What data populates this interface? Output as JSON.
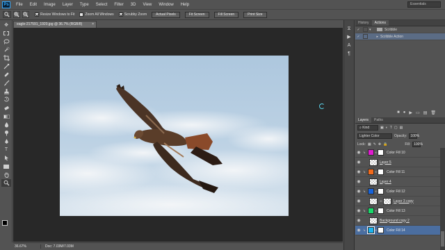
{
  "app": {
    "logo": "Ps",
    "menu": [
      "File",
      "Edit",
      "Image",
      "Layer",
      "Type",
      "Select",
      "Filter",
      "3D",
      "View",
      "Window",
      "Help"
    ],
    "workspace": "Essentials"
  },
  "options": {
    "resize_windows": "Resize Windows to Fit",
    "zoom_all": "Zoom All Windows",
    "scrubby_zoom": "Scrubby Zoom",
    "actual_pixels": "Actual Pixels",
    "fit_screen": "Fit Screen",
    "fill_screen": "Fill Screen",
    "print_size": "Print Size"
  },
  "document": {
    "tab_title": "eagle-217591_1920.jpg @ 36.7% (RGB/8)",
    "close": "×",
    "zoom": "36.67%",
    "doc_info": "Doc: 7.03M/7.03M"
  },
  "actions_panel": {
    "tabs": [
      "History",
      "Actions"
    ],
    "active_tab": "Actions",
    "rows": [
      {
        "label": "Scribble",
        "type": "set"
      },
      {
        "label": "Scribble Action",
        "type": "action"
      }
    ]
  },
  "layers_panel": {
    "tabs": [
      "Layers",
      "Paths"
    ],
    "kind_filter": "Kind",
    "blend_mode": "Lighter Color",
    "opacity_label": "Opacity:",
    "opacity": "100%",
    "lock_label": "Lock:",
    "fill_label": "Fill:",
    "fill": "100%",
    "layers": [
      {
        "name": "Color Fill 10",
        "kind": "fill",
        "color": "#e01ad0",
        "clipped": true
      },
      {
        "name": "Layer 5",
        "kind": "pixel",
        "underline": true
      },
      {
        "name": "Color Fill 11",
        "kind": "fill",
        "color": "#f26a1b",
        "clipped": true
      },
      {
        "name": "Layer 4",
        "kind": "pixel",
        "underline": true
      },
      {
        "name": "Color Fill 12",
        "kind": "fill",
        "color": "#1763d9",
        "clipped": true
      },
      {
        "name": "Layer 3 copy",
        "kind": "pixel-mask",
        "underline": true
      },
      {
        "name": "Color Fill 13",
        "kind": "fill",
        "color": "#19d86a",
        "clipped": true
      },
      {
        "name": "Background copy 2",
        "kind": "pixel",
        "underline": true
      },
      {
        "name": "Color Fill 14",
        "kind": "fill",
        "color": "#1ab4f0",
        "clipped": true,
        "selected": true
      }
    ]
  }
}
